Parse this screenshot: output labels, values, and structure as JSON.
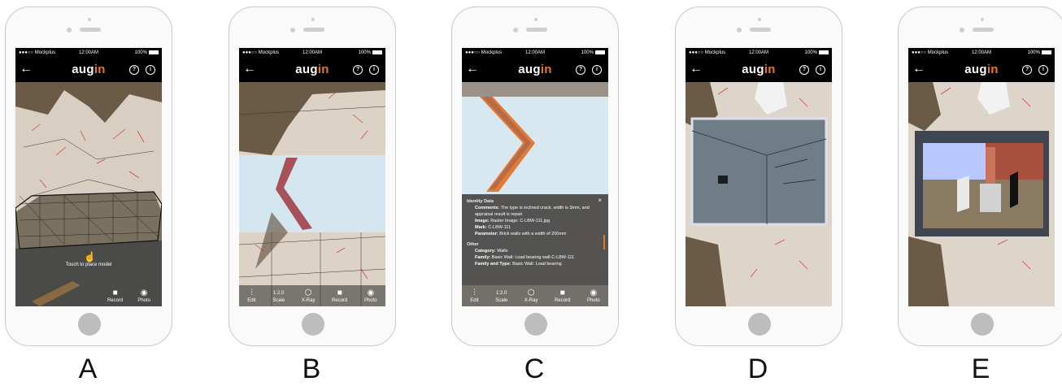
{
  "status": {
    "carrier": "●●●○○ Mockplus",
    "time": "12:00AM",
    "battery": "100%"
  },
  "app": {
    "logo_main": "aug",
    "logo_accent": "in",
    "back_glyph": "←",
    "help_glyph": "?",
    "info_glyph": "i"
  },
  "toolbar_full": [
    {
      "icon": "edit-icon",
      "glyph": "⫶",
      "label": "Edit"
    },
    {
      "icon": "scale-icon",
      "glyph": "1:2.0",
      "label": "Scale"
    },
    {
      "icon": "xray-icon",
      "glyph": "⬡",
      "label": "X-Ray"
    },
    {
      "icon": "record-icon",
      "glyph": "■",
      "label": "Record"
    },
    {
      "icon": "photo-icon",
      "glyph": "◉",
      "label": "Photo"
    }
  ],
  "toolbar_a": [
    {
      "icon": "record-icon",
      "glyph": "■",
      "label": "Record"
    },
    {
      "icon": "photo-icon",
      "glyph": "◉",
      "label": "Photo"
    }
  ],
  "screen_a": {
    "hint": "Touch to place model"
  },
  "panel": {
    "section1": "Identity Data",
    "comments_k": "Comments:",
    "comments_v": "The type is inclined crack, width is 3mm, and appraisal result is repair",
    "image_k": "Image:",
    "image_v": "Raster Image: C-LBW-111.jpg",
    "mark_k": "Mark:",
    "mark_v": "C-LBW-111",
    "param_k": "Parameter:",
    "param_v": "Brick walls with a width of 200mm",
    "section2": "Other",
    "category_k": "Category:",
    "category_v": "Walls",
    "family_k": "Family:",
    "family_v": "Basic Wall: Load bearing wall-C-LBW-111",
    "famtype_k": "Family and Type:",
    "famtype_v": "Basic Wall: Load bearing",
    "close": "×"
  },
  "captions": [
    "A",
    "B",
    "C",
    "D",
    "E"
  ]
}
